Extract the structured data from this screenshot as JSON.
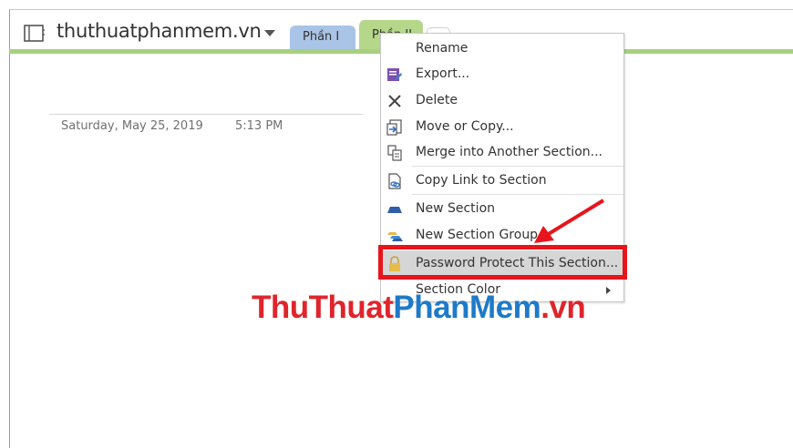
{
  "header": {
    "notebook_title": "thuthuatphanmem.vn",
    "tabs": [
      {
        "label": "Phần I"
      },
      {
        "label": "Phần II"
      }
    ]
  },
  "page": {
    "date": "Saturday, May 25, 2019",
    "time": "5:13 PM"
  },
  "context_menu": {
    "items": [
      {
        "label": "Rename",
        "icon": "rename-icon"
      },
      {
        "label": "Export...",
        "icon": "export-icon"
      },
      {
        "label": "Delete",
        "icon": "delete-x-icon"
      },
      {
        "label": "Move or Copy...",
        "icon": "move-copy-icon"
      },
      {
        "label": "Merge into Another Section...",
        "icon": "merge-icon"
      },
      {
        "label": "Copy Link to Section",
        "icon": "copy-link-icon"
      },
      {
        "label": "New Section",
        "icon": "new-section-icon"
      },
      {
        "label": "New Section Group",
        "icon": "new-section-group-icon"
      },
      {
        "label": "Password Protect This Section...",
        "icon": "lock-icon"
      },
      {
        "label": "Section Color",
        "icon": "submenu-arrow-icon"
      }
    ]
  },
  "watermark": {
    "part1": "ThuThuat",
    "part2": "PhanMem",
    "part3": ".vn"
  },
  "colors": {
    "tab_blue": "#a9c4e6",
    "tab_green": "#b5d78a",
    "highlight_red": "#e8141b",
    "watermark_red": "#e0242b",
    "watermark_blue": "#1e7ac8"
  }
}
